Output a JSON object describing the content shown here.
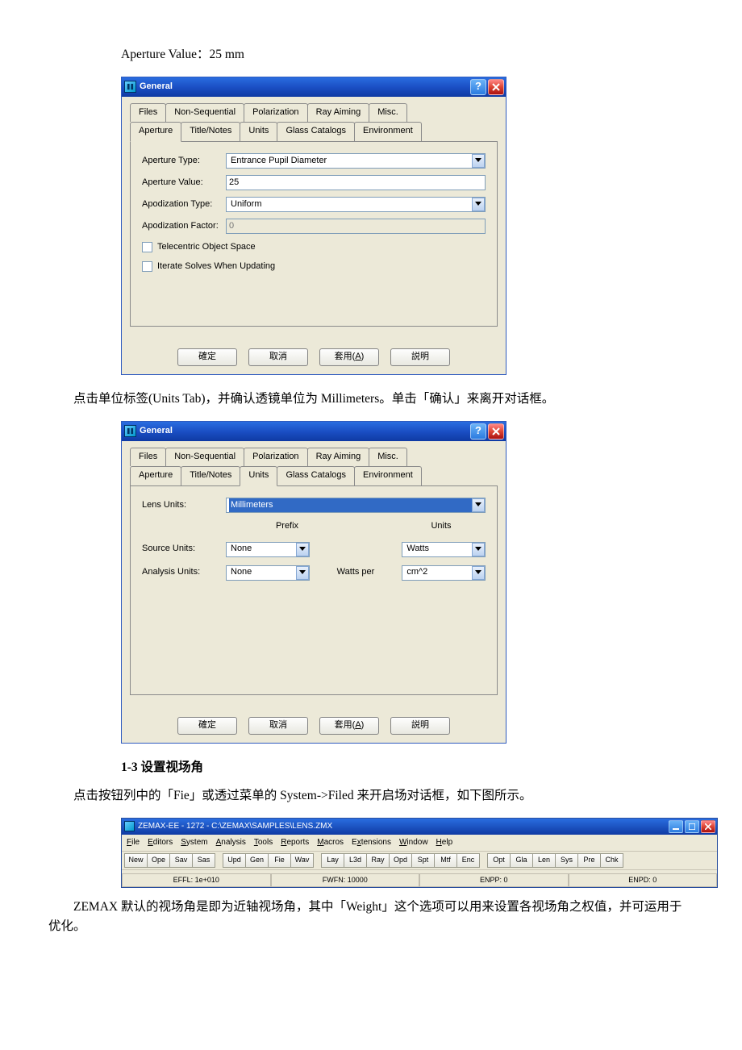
{
  "texts": {
    "top_line": "Aperture Value：25 mm",
    "para1": "点击单位标签(Units Tab)，并确认透镜单位为 Millimeters。单击「确认」来离开对话框。",
    "heading": "1-3 设置视场角",
    "para2": "点击按钮列中的「Fie」或透过菜单的 System->Filed 来开启场对话框，如下图所示。",
    "para3": "ZEMAX 默认的视场角是即为近轴视场角，其中「Weight」这个选项可以用来设置各视场角之权值，并可运用于优化。"
  },
  "dlg_common": {
    "title": "General",
    "tabs_row1": [
      "Files",
      "Non-Sequential",
      "Polarization",
      "Ray Aiming",
      "Misc."
    ],
    "tabs_row2": [
      "Aperture",
      "Title/Notes",
      "Units",
      "Glass Catalogs",
      "Environment"
    ],
    "btn_ok": "確定",
    "btn_cancel": "取消",
    "btn_apply_prefix": "套用(",
    "btn_apply_key": "A",
    "btn_apply_suffix": ")",
    "btn_help": "説明"
  },
  "dlg_aperture": {
    "lbl_type": "Aperture Type:",
    "val_type": "Entrance Pupil Diameter",
    "lbl_value": "Aperture Value:",
    "val_value": "25",
    "lbl_apod_type": "Apodization Type:",
    "val_apod_type": "Uniform",
    "lbl_apod_factor": "Apodization Factor:",
    "val_apod_factor": "0",
    "chk_tele": "Telecentric Object Space",
    "chk_iter": "Iterate Solves When Updating"
  },
  "dlg_units": {
    "lbl_lens": "Lens Units:",
    "val_lens": "Millimeters",
    "hdr_prefix": "Prefix",
    "hdr_units": "Units",
    "lbl_source": "Source Units:",
    "val_source_prefix": "None",
    "val_source_units": "Watts",
    "lbl_analysis": "Analysis Units:",
    "val_analysis_prefix": "None",
    "mid_text": "Watts per",
    "val_analysis_units": "cm^2"
  },
  "appwin": {
    "title": "ZEMAX-EE - 1272 - C:\\ZEMAX\\SAMPLES\\LENS.ZMX",
    "menu_file": "File",
    "menu_editors": "Editors",
    "menu_system": "System",
    "menu_analysis": "Analysis",
    "menu_tools": "Tools",
    "menu_reports": "Reports",
    "menu_macros": "Macros",
    "menu_extensions": "Extensions",
    "menu_window": "Window",
    "menu_help": "Help",
    "tb": [
      "New",
      "Ope",
      "Sav",
      "Sas",
      "Upd",
      "Gen",
      "Fie",
      "Wav",
      "Lay",
      "L3d",
      "Ray",
      "Opd",
      "Spt",
      "Mtf",
      "Enc",
      "Opt",
      "Gla",
      "Len",
      "Sys",
      "Pre",
      "Chk"
    ],
    "status": [
      "EFFL: 1e+010",
      "FWFN: 10000",
      "ENPP: 0",
      "ENPD: 0"
    ]
  }
}
